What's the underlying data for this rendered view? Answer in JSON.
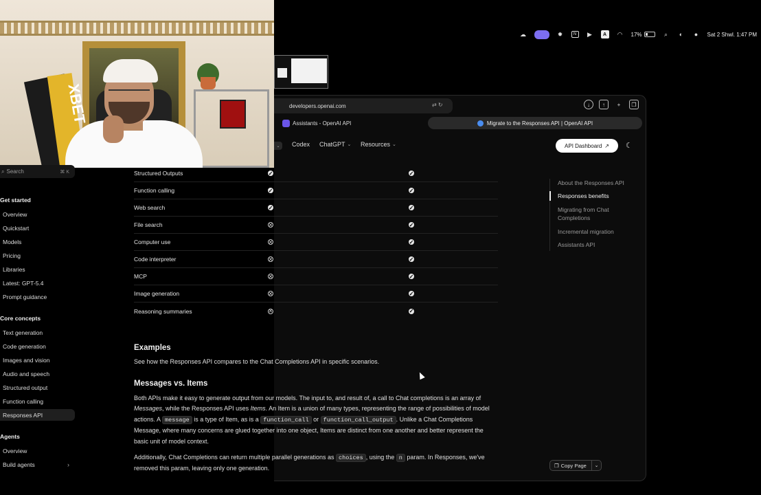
{
  "menubar": {
    "battery": "17%",
    "clock": "Sat 2 Shwl.  1:47 PM",
    "icons": [
      "cloud-icon",
      "screen-record-icon",
      "sun-icon",
      "n-box-icon",
      "play-icon",
      "input-A-icon",
      "wifi-icon",
      "battery-icon",
      "search-icon",
      "control-center-icon",
      "siri-icon"
    ]
  },
  "browser": {
    "url": "developers.openai.com",
    "tabs": [
      {
        "label": "Assistants - OpenAI API"
      },
      {
        "label": "Migrate to the Responses API | OpenAI API"
      }
    ],
    "nav": {
      "items": [
        "Codex",
        "ChatGPT",
        "Resources"
      ],
      "dashboard": "API Dashboard"
    }
  },
  "sidebar": {
    "search_placeholder": "Search",
    "search_kbd": "⌘  K",
    "sections": [
      {
        "title": "Get started",
        "items": [
          "Overview",
          "Quickstart",
          "Models",
          "Pricing",
          "Libraries",
          "Latest: GPT-5.4",
          "Prompt guidance"
        ]
      },
      {
        "title": "Core concepts",
        "items": [
          "Text generation",
          "Code generation",
          "Images and vision",
          "Audio and speech",
          "Structured output",
          "Function calling",
          "Responses API"
        ]
      },
      {
        "title": "Agents",
        "items": [
          "Overview",
          "Build agents"
        ]
      }
    ]
  },
  "table": {
    "rows": [
      {
        "feature": "Structured Outputs",
        "c1": true,
        "c2": true
      },
      {
        "feature": "Function calling",
        "c1": true,
        "c2": true
      },
      {
        "feature": "Web search",
        "c1": true,
        "c2": true
      },
      {
        "feature": "File search",
        "c1": false,
        "c2": true
      },
      {
        "feature": "Computer use",
        "c1": false,
        "c2": true
      },
      {
        "feature": "Code interpreter",
        "c1": false,
        "c2": true
      },
      {
        "feature": "MCP",
        "c1": false,
        "c2": true
      },
      {
        "feature": "Image generation",
        "c1": false,
        "c2": true
      },
      {
        "feature": "Reasoning summaries",
        "c1": false,
        "c2": true
      }
    ]
  },
  "content": {
    "examples_heading": "Examples",
    "examples_text": "See how the Responses API compares to the Chat Completions API in specific scenarios.",
    "messages_heading": "Messages vs. Items",
    "p1": {
      "a": "Both APIs make it easy to generate output from our models. The input to, and result of, a call to Chat completions is an array of ",
      "b": "Messages",
      "c": ", while the Responses API uses ",
      "d": "Items",
      "e": ". An Item is a union of many types, representing the range of possibilities of model actions. A ",
      "code1": "message",
      "f": " is a type of Item, as is a ",
      "code2": "function_call",
      "g": " or ",
      "code3": "function_call_output",
      "h": ". Unlike a Chat Completions Message, where many concerns are glued together into one object, Items are distinct from one another and better represent the basic unit of model context."
    },
    "p2": {
      "a": "Additionally, Chat Completions can return multiple parallel generations as ",
      "code1": "choices",
      "b": ", using the ",
      "code2": "n",
      "c": " param. In Responses, we've removed this param, leaving only one generation."
    }
  },
  "toc": {
    "items": [
      "About the Responses API",
      "Responses benefits",
      "Migrating from Chat Completions",
      "Incremental migration",
      "Assistants API"
    ],
    "active": "Responses benefits"
  },
  "copy_page": "Copy Page",
  "webcam": {
    "brand": "XBET"
  }
}
